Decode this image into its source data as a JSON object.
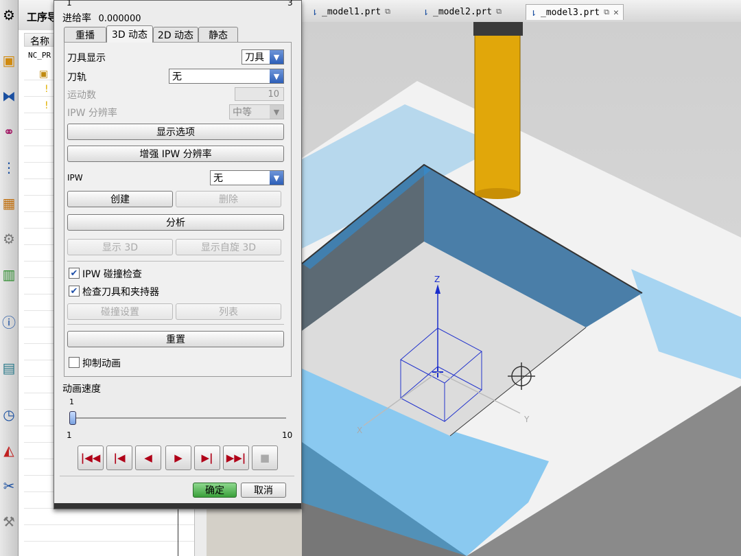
{
  "nav": {
    "title": "工序导",
    "column_name": "名称",
    "root_item": "NC_PR"
  },
  "file_tabs": [
    {
      "name": "_model1.prt"
    },
    {
      "name": "_model2.prt"
    },
    {
      "name": "_model3.prt"
    }
  ],
  "dialog": {
    "slider_top_left": "1",
    "slider_top_right": "3",
    "feed_label": "进给率",
    "feed_value": "0.000000",
    "tabs": [
      "重播",
      "3D 动态",
      "2D 动态",
      "静态"
    ],
    "tool_display_label": "刀具显示",
    "tool_display_value": "刀具",
    "toolpath_label": "刀轨",
    "toolpath_value": "无",
    "motions_label": "运动数",
    "motions_value": "10",
    "ipw_res_label": "IPW 分辨率",
    "ipw_res_value": "中等",
    "display_options_btn": "显示选项",
    "enhance_ipw_btn": "增强 IPW 分辨率",
    "ipw_label": "IPW",
    "ipw_value": "无",
    "create_btn": "创建",
    "delete_btn": "删除",
    "analyze_btn": "分析",
    "show3d_btn": "显示 3D",
    "show_spin_btn": "显示自旋 3D",
    "ipw_collision_label": "IPW 碰撞检查",
    "check_holder_label": "检查刀具和夹持器",
    "collision_settings_btn": "碰撞设置",
    "list_btn": "列表",
    "reset_btn": "重置",
    "suppress_anim_label": "抑制动画",
    "anim_speed_label": "动画速度",
    "speed_current": "1",
    "speed_min": "1",
    "speed_max": "10",
    "speed_level": 1,
    "ok_btn": "确定",
    "cancel_btn": "取消"
  },
  "viewport": {
    "axis_z": "Z",
    "axis_x": "X",
    "axis_y": "Y"
  },
  "colors": {
    "accent_blue": "#2d5fb8",
    "play_red": "#b00018",
    "tool_yellow": "#e1a70a",
    "ok_green": "#3aa03a"
  }
}
